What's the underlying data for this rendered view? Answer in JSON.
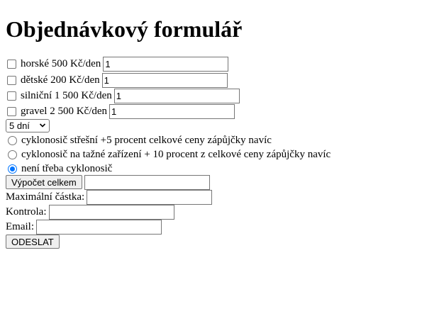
{
  "page_title": "Objednávkový formulář",
  "bikes": [
    {
      "label": "horské 500 Kč/den",
      "value": "1"
    },
    {
      "label": "dětské 200 Kč/den",
      "value": "1"
    },
    {
      "label": "silniční 1 500 Kč/den",
      "value": "1"
    },
    {
      "label": "gravel 2 500 Kč/den",
      "value": "1"
    }
  ],
  "duration": {
    "selected": "5 dní"
  },
  "rack_options": [
    {
      "label": "cyklonosič střešní +5 procent celkové ceny zápůjčky navíc",
      "checked": false
    },
    {
      "label": "cyklonosič na tažné zařízení + 10 procent z celkové ceny zápůjčky navíc",
      "checked": false
    },
    {
      "label": "není třeba cyklonosič",
      "checked": true
    }
  ],
  "calc": {
    "button_label": "Výpočet celkem",
    "result": ""
  },
  "max_amount": {
    "label": "Maximální částka:",
    "value": ""
  },
  "check": {
    "label": "Kontrola:",
    "value": ""
  },
  "email": {
    "label": "Email:",
    "value": ""
  },
  "submit": {
    "label": "ODESLAT"
  },
  "colors": {
    "radio_accent": "#0075ff",
    "border": "#767676",
    "button_bg": "#efefef"
  }
}
